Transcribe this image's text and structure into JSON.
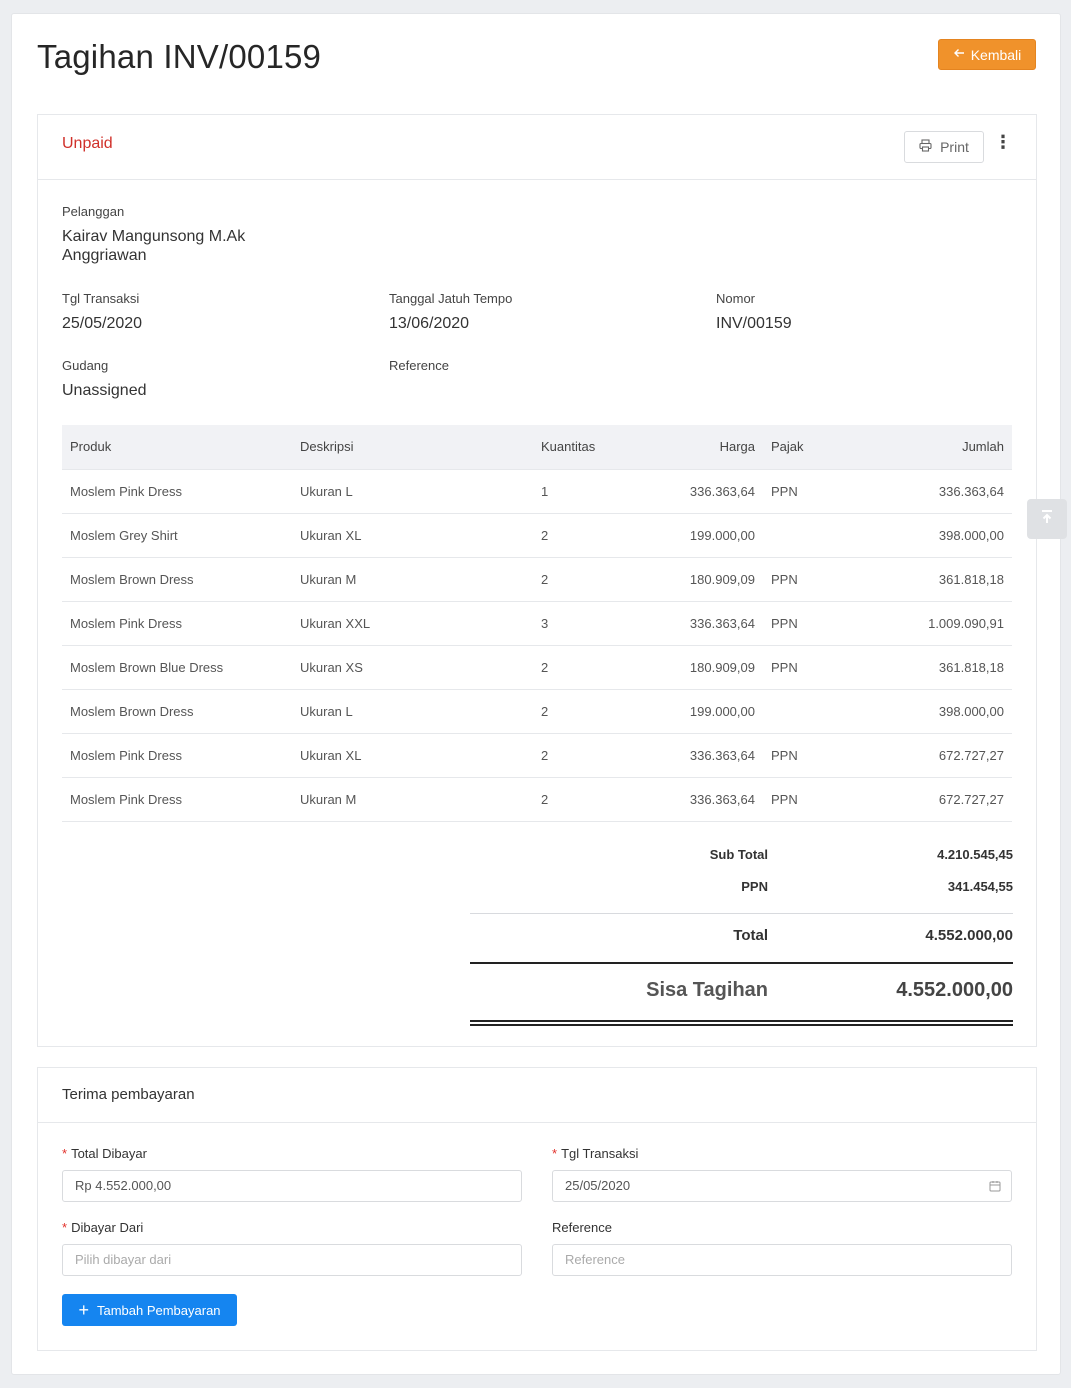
{
  "header": {
    "title": "Tagihan INV/00159",
    "back_label": "Kembali",
    "back_icon": "arrow-left-icon"
  },
  "invoice": {
    "status": "Unpaid",
    "print_label": "Print",
    "more_icon": "more-vertical-icon",
    "pelanggan_label": "Pelanggan",
    "pelanggan_value_line1": "Kairav Mangunsong M.Ak",
    "pelanggan_value_line2": "Anggriawan",
    "tgl_transaksi_label": "Tgl Transaksi",
    "tgl_transaksi_value": "25/05/2020",
    "jatuh_tempo_label": "Tanggal Jatuh Tempo",
    "jatuh_tempo_value": "13/06/2020",
    "nomor_label": "Nomor",
    "nomor_value": "INV/00159",
    "gudang_label": "Gudang",
    "gudang_value": "Unassigned",
    "reference_label": "Reference",
    "reference_value": ""
  },
  "table": {
    "headers": [
      "Produk",
      "Deskripsi",
      "Kuantitas",
      "Harga",
      "Pajak",
      "Jumlah"
    ],
    "rows": [
      [
        "Moslem Pink Dress",
        "Ukuran L",
        "1",
        "336.363,64",
        "PPN",
        "336.363,64"
      ],
      [
        "Moslem Grey Shirt",
        "Ukuran XL",
        "2",
        "199.000,00",
        "",
        "398.000,00"
      ],
      [
        "Moslem Brown Dress",
        "Ukuran M",
        "2",
        "180.909,09",
        "PPN",
        "361.818,18"
      ],
      [
        "Moslem Pink Dress",
        "Ukuran XXL",
        "3",
        "336.363,64",
        "PPN",
        "1.009.090,91"
      ],
      [
        "Moslem Brown Blue Dress",
        "Ukuran XS",
        "2",
        "180.909,09",
        "PPN",
        "361.818,18"
      ],
      [
        "Moslem Brown Dress",
        "Ukuran L",
        "2",
        "199.000,00",
        "",
        "398.000,00"
      ],
      [
        "Moslem Pink Dress",
        "Ukuran XL",
        "2",
        "336.363,64",
        "PPN",
        "672.727,27"
      ],
      [
        "Moslem Pink Dress",
        "Ukuran M",
        "2",
        "336.363,64",
        "PPN",
        "672.727,27"
      ]
    ]
  },
  "totals": {
    "subtotal_label": "Sub Total",
    "subtotal_value": "4.210.545,45",
    "ppn_label": "PPN",
    "ppn_value": "341.454,55",
    "total_label": "Total",
    "total_value": "4.552.000,00",
    "sisa_label": "Sisa Tagihan",
    "sisa_value": "4.552.000,00"
  },
  "payment": {
    "title": "Terima pembayaran",
    "total_dibayar_label": "Total Dibayar",
    "total_dibayar_value": "Rp 4.552.000,00",
    "tgl_transaksi_label": "Tgl Transaksi",
    "tgl_transaksi_value": "25/05/2020",
    "dibayar_dari_label": "Dibayar Dari",
    "dibayar_dari_placeholder": "Pilih dibayar dari",
    "reference_label": "Reference",
    "reference_placeholder": "Reference",
    "add_label": "Tambah Pembayaran",
    "required_mark": "*"
  },
  "colors": {
    "accent_orange": "#f0922b",
    "primary_blue": "#1585f0",
    "status_red": "#d0302a"
  }
}
